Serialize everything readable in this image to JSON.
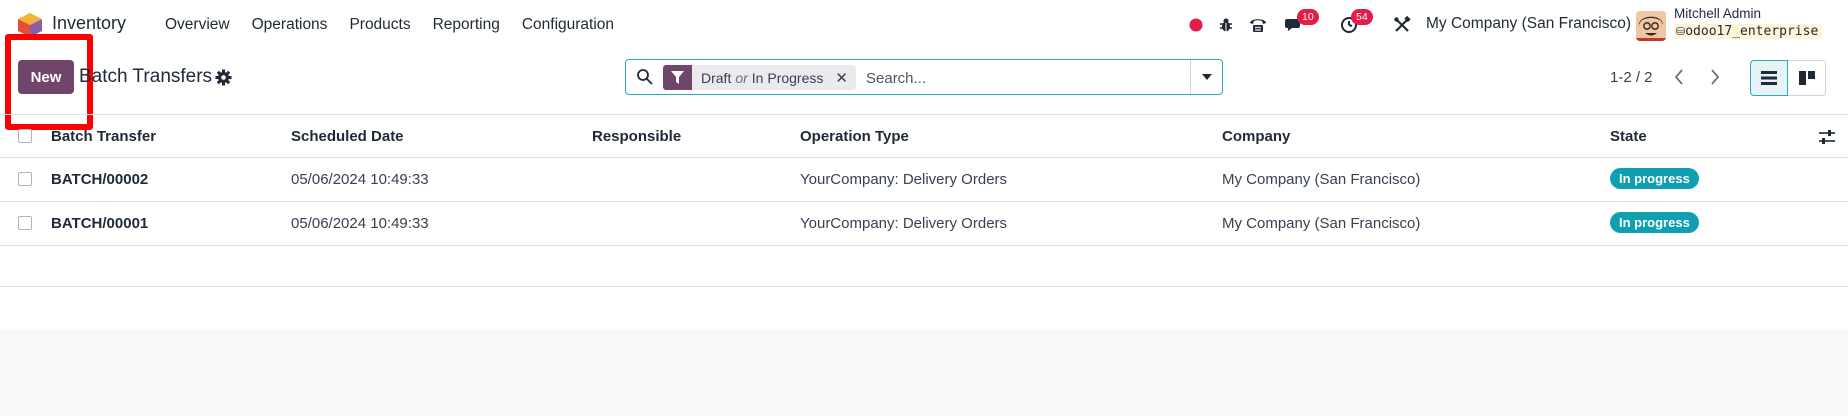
{
  "app": {
    "name": "Inventory",
    "logo_icon": "odoo-inventory-logo",
    "accent": "#71456a"
  },
  "menu": {
    "items": [
      "Overview",
      "Operations",
      "Products",
      "Reporting",
      "Configuration"
    ]
  },
  "systray": {
    "recording_icon": "red-dot-icon",
    "debug_icon": "bug-icon",
    "phone_icon": "phone-icon",
    "messages_count": "10",
    "activities_count": "54",
    "tools_icon": "tools-icon",
    "company": "My Company (San Francisco)",
    "user_name": "Mitchell Admin",
    "database": "odoo17_enterprise"
  },
  "control_panel": {
    "new_label": "New",
    "title": "Batch Transfers",
    "search": {
      "facet_part1": "Draft",
      "facet_or": "or",
      "facet_part2": "In Progress",
      "placeholder": "Search..."
    },
    "pager": "1-2 / 2"
  },
  "table": {
    "columns": [
      "Batch Transfer",
      "Scheduled Date",
      "Responsible",
      "Operation Type",
      "Company",
      "State"
    ],
    "rows": [
      {
        "name": "BATCH/00002",
        "scheduled_date": "05/06/2024 10:49:33",
        "responsible": "",
        "operation_type": "YourCompany: Delivery Orders",
        "company": "My Company (San Francisco)",
        "state": "In progress"
      },
      {
        "name": "BATCH/00001",
        "scheduled_date": "05/06/2024 10:49:33",
        "responsible": "",
        "operation_type": "YourCompany: Delivery Orders",
        "company": "My Company (San Francisco)",
        "state": "In progress"
      }
    ],
    "state_color": "#0f9fb0"
  }
}
